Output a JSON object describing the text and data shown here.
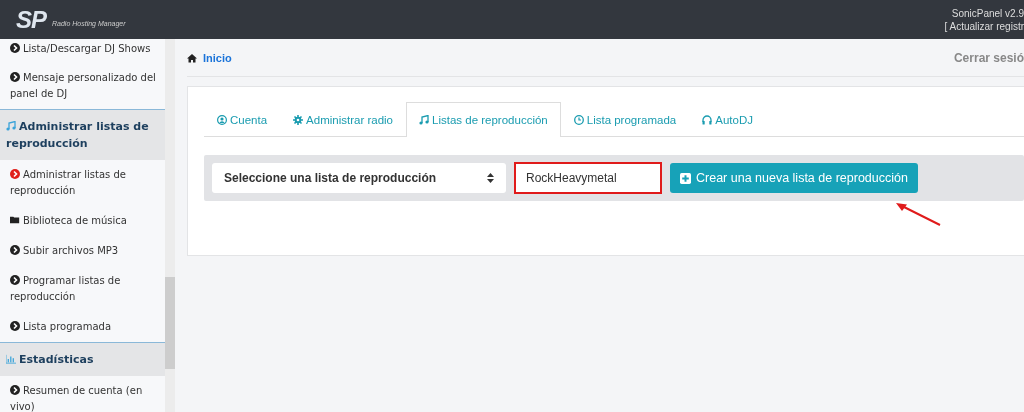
{
  "header": {
    "logo": "SP",
    "tagline": "Radio Hosting Manager",
    "version": "SonicPanel v2.9",
    "update_link": "[ Actualizar registr"
  },
  "sidebar": {
    "items": [
      {
        "kind": "link",
        "label": "Lista/Descargar DJ Shows",
        "selected": false
      },
      {
        "kind": "link",
        "label": "Mensaje personalizado del panel de DJ",
        "selected": false
      },
      {
        "kind": "playlists",
        "label": "Administrar listas de reproducción",
        "selected": false
      },
      {
        "kind": "link",
        "label": "Administrar listas de reproducción",
        "selected": true
      },
      {
        "kind": "library",
        "label": "Biblioteca de música",
        "selected": false
      },
      {
        "kind": "link",
        "label": "Subir archivos MP3",
        "selected": false
      },
      {
        "kind": "link",
        "label": "Programar listas de reproducción",
        "selected": false
      },
      {
        "kind": "link",
        "label": "Lista programada",
        "selected": false
      },
      {
        "kind": "statistics",
        "label": "Estadísticas",
        "selected": false
      },
      {
        "kind": "link",
        "label": "Resumen de cuenta (en vivo)",
        "selected": false
      }
    ]
  },
  "breadcrumb": {
    "label": "Inicio"
  },
  "logout": "Cerrar sesió",
  "tabs": [
    {
      "label": "Cuenta",
      "selected": false
    },
    {
      "label": "Administrar radio",
      "selected": false
    },
    {
      "label": "Listas de reproducción",
      "selected": true
    },
    {
      "label": "Lista programada",
      "selected": false
    },
    {
      "label": "AutoDJ",
      "selected": false
    }
  ],
  "toolbar": {
    "select": {
      "value": "Seleccione una lista de reproducción"
    },
    "name_field": {
      "value": "RockHeavymetal",
      "highlighted": true
    },
    "create_button": "Crear una nueva lista de reproducción",
    "arrow_annotation": true
  }
}
